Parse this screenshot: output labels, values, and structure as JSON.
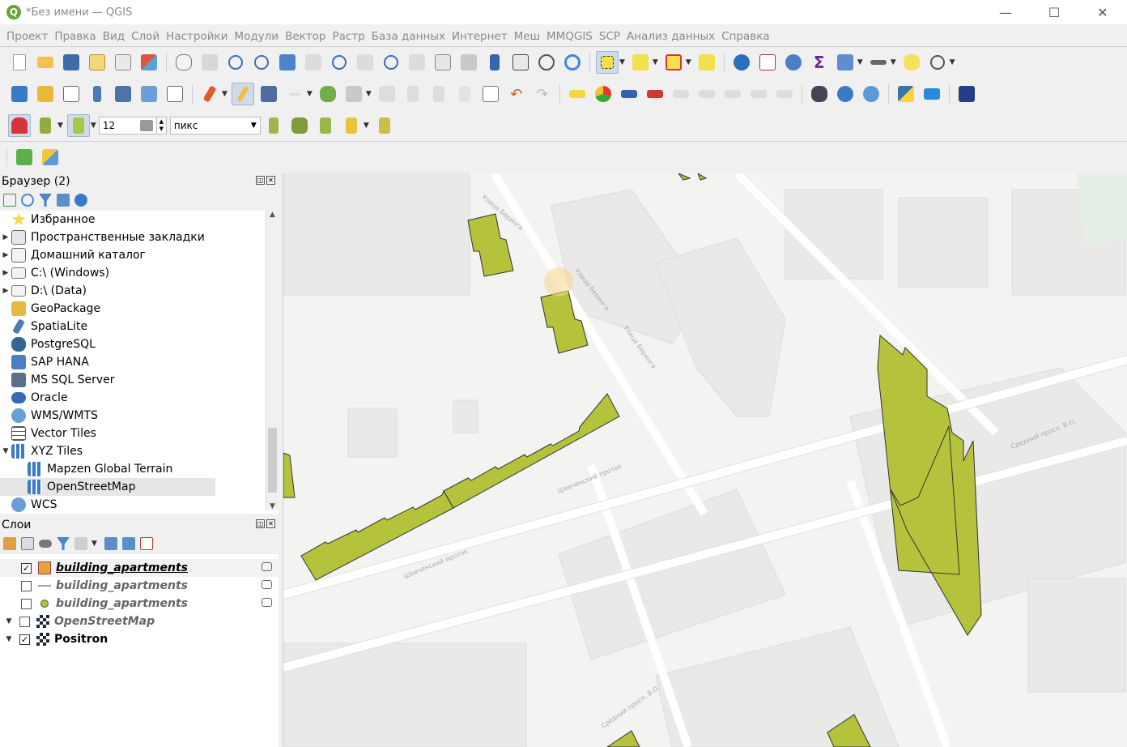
{
  "window": {
    "title": "*Без имени — QGIS"
  },
  "menubar": [
    "Проект",
    "Правка",
    "Вид",
    "Слой",
    "Настройки",
    "Модули",
    "Вектор",
    "Растр",
    "База данных",
    "Интернет",
    "Меш",
    "MMQGIS",
    "SCP",
    "Анализ данных",
    "Справка"
  ],
  "digitizing": {
    "snap_tolerance": "12",
    "snap_units": "пикс"
  },
  "browser": {
    "title": "Браузер (2)",
    "items": [
      {
        "label": "Избранное",
        "icon": "star-icon",
        "expander": ""
      },
      {
        "label": "Пространственные закладки",
        "icon": "bookmarks-icon",
        "expander": "▶"
      },
      {
        "label": "Домашний каталог",
        "icon": "home-folder-icon",
        "expander": "▶"
      },
      {
        "label": "C:\\ (Windows)",
        "icon": "folder-icon",
        "expander": "▶"
      },
      {
        "label": "D:\\ (Data)",
        "icon": "folder-icon",
        "expander": "▶"
      },
      {
        "label": "GeoPackage",
        "icon": "geopackage-icon",
        "expander": ""
      },
      {
        "label": "SpatiaLite",
        "icon": "spatialite-icon",
        "expander": ""
      },
      {
        "label": "PostgreSQL",
        "icon": "postgresql-icon",
        "expander": ""
      },
      {
        "label": "SAP HANA",
        "icon": "sap-hana-icon",
        "expander": ""
      },
      {
        "label": "MS SQL Server",
        "icon": "mssql-icon",
        "expander": ""
      },
      {
        "label": "Oracle",
        "icon": "oracle-icon",
        "expander": ""
      },
      {
        "label": "WMS/WMTS",
        "icon": "globe-icon",
        "expander": ""
      },
      {
        "label": "Vector Tiles",
        "icon": "grid-icon",
        "expander": ""
      },
      {
        "label": "XYZ Tiles",
        "icon": "tiles-icon",
        "expander": "▼"
      },
      {
        "label": "Mapzen Global Terrain",
        "icon": "tiles-icon",
        "expander": "",
        "indent": true
      },
      {
        "label": "OpenStreetMap",
        "icon": "tiles-icon",
        "expander": "",
        "indent": true,
        "selected": true
      },
      {
        "label": "WCS",
        "icon": "globe-icon",
        "expander": ""
      }
    ]
  },
  "layers": {
    "title": "Слои",
    "items": [
      {
        "label": "building_apartments",
        "checked": true,
        "icon": "edit-pencil-icon",
        "style": "edit",
        "expander": ""
      },
      {
        "label": "building_apartments",
        "checked": false,
        "icon": "line-symbol-icon",
        "style": "italic",
        "expander": ""
      },
      {
        "label": "building_apartments",
        "checked": false,
        "icon": "point-symbol-icon",
        "style": "italic",
        "expander": ""
      },
      {
        "label": "OpenStreetMap",
        "checked": false,
        "icon": "raster-tiles-icon",
        "style": "italic",
        "expander": "▼"
      },
      {
        "label": "Positron",
        "checked": true,
        "icon": "raster-tiles-icon",
        "style": "plain",
        "expander": "▼"
      }
    ]
  },
  "map": {
    "polygon_fill": "#b5c33c",
    "polygon_stroke": "#333333",
    "street_labels": [
      "Улица Беринга",
      "Улица Беринга",
      "Улица Беринга",
      "Шевченский проток",
      "Шевченский проток",
      "Средний просп. В.О.",
      "Средний просп. В.О."
    ]
  },
  "colors": {
    "accent": "#69a335",
    "selection": "#cfdbe8"
  }
}
